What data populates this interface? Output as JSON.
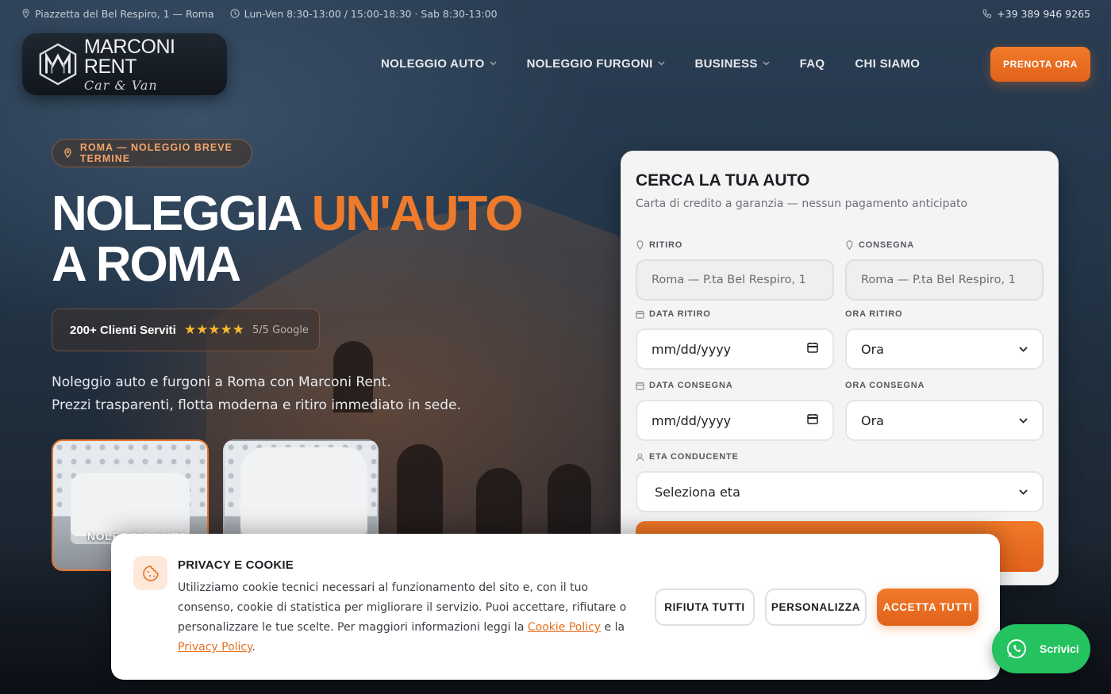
{
  "topbar": {
    "address": "Piazzetta del Bel Respiro, 1 — Roma",
    "hours": "Lun-Ven 8:30-13:00 / 15:00-18:30 · Sab 8:30-13:00",
    "phone": "+39 389 946 9265"
  },
  "logo": {
    "name": "MARCONI RENT",
    "tagline": "Car & Van",
    "mark": "MM"
  },
  "nav": {
    "items": [
      {
        "label": "NOLEGGIO AUTO",
        "dropdown": true
      },
      {
        "label": "NOLEGGIO FURGONI",
        "dropdown": true
      },
      {
        "label": "BUSINESS",
        "dropdown": true
      },
      {
        "label": "FAQ",
        "dropdown": false
      },
      {
        "label": "CHI SIAMO",
        "dropdown": false
      }
    ],
    "cta": "PRENOTA ORA"
  },
  "hero": {
    "badge": "ROMA — NOLEGGIO BREVE TERMINE",
    "title_line1_a": "NOLEGGIA ",
    "title_line1_b": "UN'AUTO",
    "title_line2": "A ROMA",
    "clients": "200+ Clienti Serviti",
    "stars": "★★★★★",
    "rating": "5/5 Google",
    "lead_line1": "Noleggio auto e furgoni a Roma con Marconi Rent.",
    "lead_line2": "Prezzi trasparenti, flotta moderna e ritiro immediato in sede.",
    "cards": [
      {
        "label": "NOLEGGIO AUTO"
      },
      {
        "label": ""
      }
    ]
  },
  "search": {
    "title": "CERCA LA TUA AUTO",
    "subtitle": "Carta di credito a garanzia — nessun pagamento anticipato",
    "pickup_label": "RITIRO",
    "pickup_value": "Roma — P.ta Bel Respiro, 1",
    "dropoff_label": "CONSEGNA",
    "dropoff_value": "Roma — P.ta Bel Respiro, 1",
    "pickup_date_label": "DATA RITIRO",
    "pickup_date_value": "mm/dd/yyyy",
    "pickup_time_label": "ORA RITIRO",
    "pickup_time_value": "Ora",
    "return_date_label": "DATA CONSEGNA",
    "return_date_value": "mm/dd/yyyy",
    "return_time_label": "ORA CONSEGNA",
    "return_time_value": "Ora",
    "age_label": "ETA CONDUCENTE",
    "age_value": "Seleziona eta"
  },
  "cookie": {
    "title": "PRIVACY E COOKIE",
    "text": "Utilizziamo cookie tecnici necessari al funzionamento del sito e, con il tuo consenso, cookie di statistica per migliorare il servizio. Puoi accettare, rifiutare o personalizzare le tue scelte. Per maggiori informazioni leggi la ",
    "cookie_link": "Cookie Policy",
    "and": " e la ",
    "privacy_link": "Privacy Policy",
    "end": ".",
    "reject": "RIFIUTA TUTTI",
    "customize": "PERSONALIZZA",
    "accept": "ACCETTA TUTTI"
  },
  "whatsapp": {
    "label": "Scrivici"
  },
  "colors": {
    "accent": "#ee7a2c",
    "whatsapp": "#25c260",
    "star": "#f5b82e"
  }
}
